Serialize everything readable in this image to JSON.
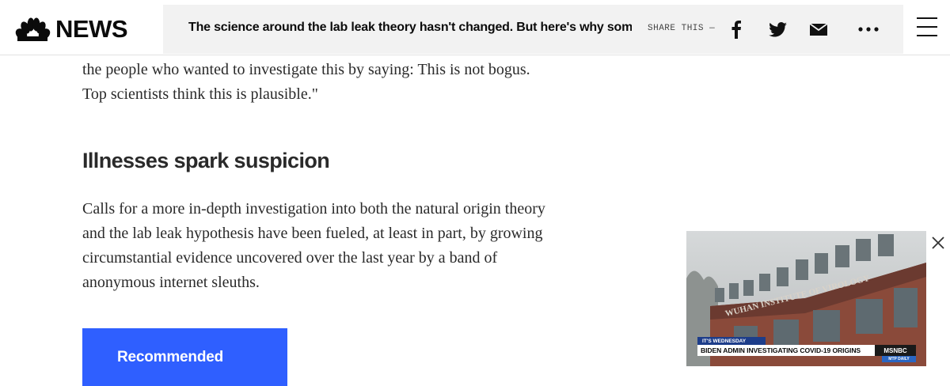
{
  "header": {
    "logo_text": "NEWS",
    "headline": "The science around the lab leak theory hasn't changed. But here's why some scien",
    "share_label": "SHARE THIS —",
    "share_icons": [
      "facebook-icon",
      "twitter-icon",
      "email-icon",
      "more-icon"
    ],
    "menu_icon": "hamburger-menu-icon"
  },
  "article": {
    "paragraph_top": "the people who wanted to investigate this by saying: This is not bogus. Top scientists think this is plausible.\"",
    "subheading": "Illnesses spark suspicion",
    "paragraph_2": "Calls for a more in-depth investigation into both the natural origin theory and the lab leak hypothesis have been fueled, at least in part, by growing circumstantial evidence uncovered over the last year by a band of anonymous internet sleuths.",
    "recommended_label": "Recommended"
  },
  "video": {
    "tag": "IT'S WEDNESDAY",
    "lower_third": "BIDEN ADMIN INVESTIGATING COVID-19 ORIGINS",
    "network": "MSNBC",
    "program": "MTP DAILY",
    "sign_text": "WUHAN INSTITUTE OF VIROLOGY",
    "close_icon": "close-icon"
  },
  "colors": {
    "accent_button": "#2f5fff",
    "headline_bar": "#f2f2f2",
    "text": "#2a2a2a"
  }
}
